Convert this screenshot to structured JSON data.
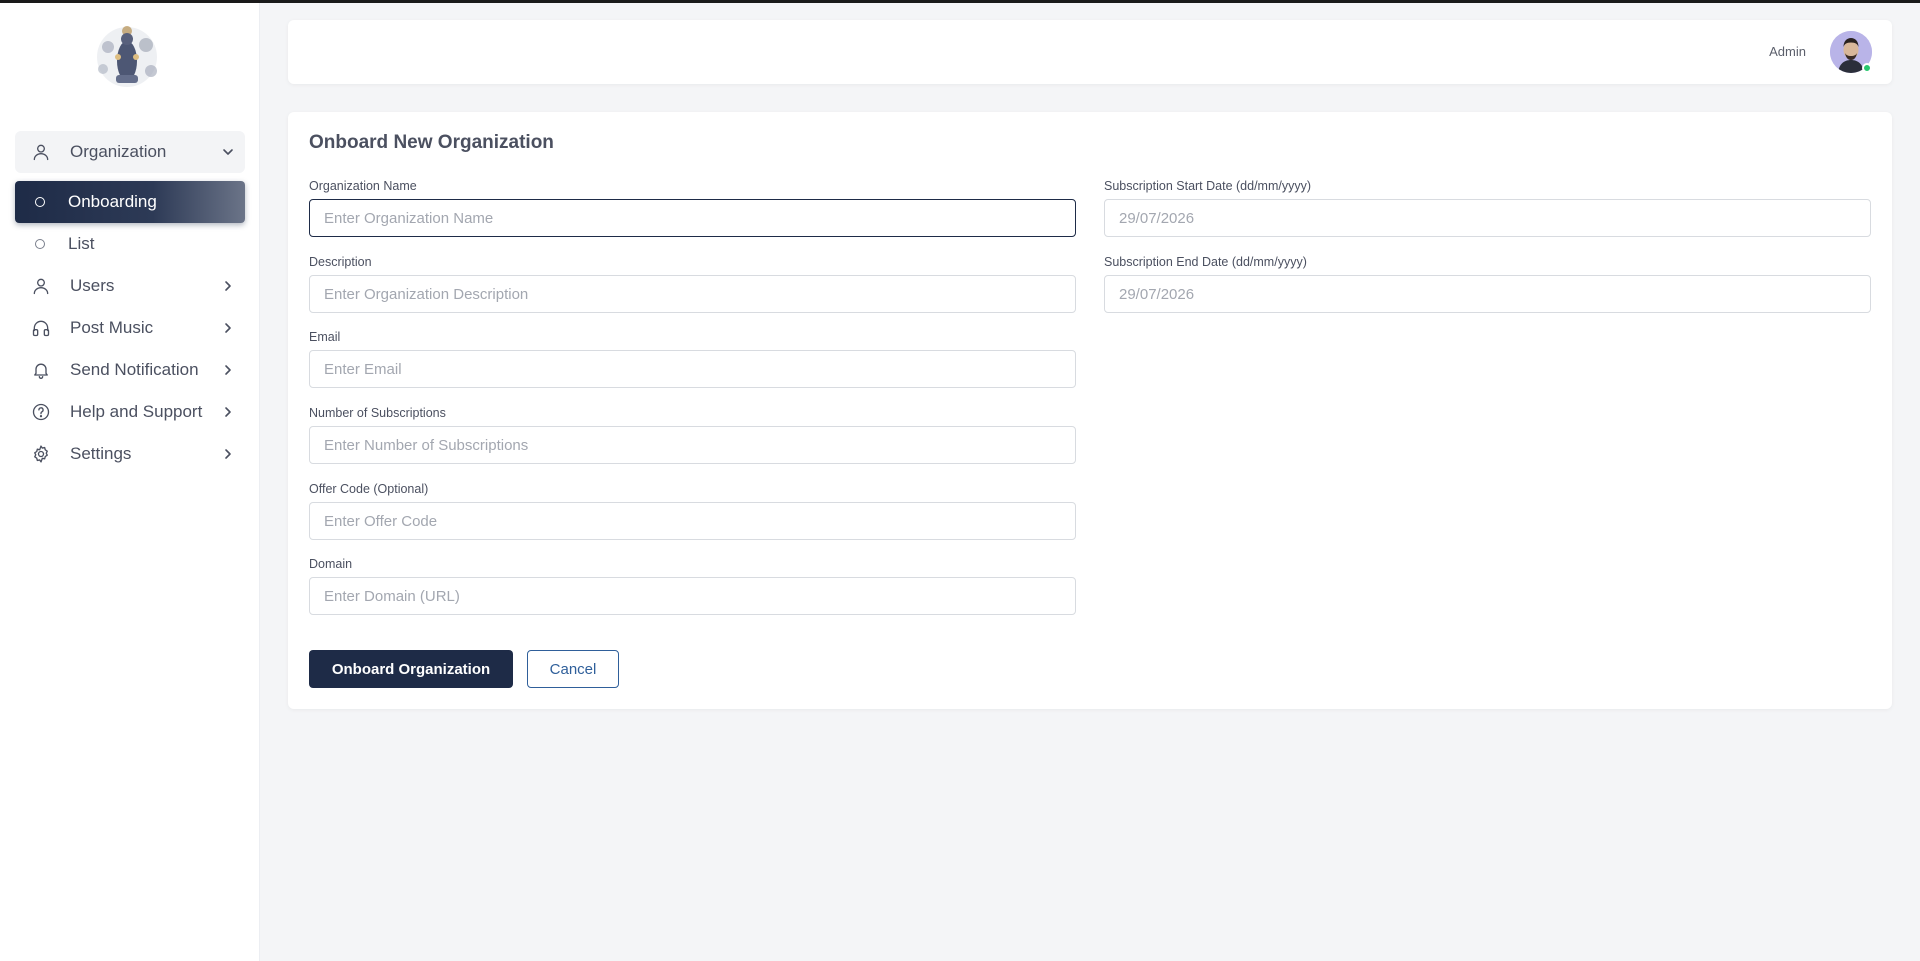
{
  "header": {
    "user_label": "Admin",
    "online_color": "#28c76f"
  },
  "sidebar": {
    "items": [
      {
        "label": "Organization",
        "icon": "user-icon",
        "expanded": true
      },
      {
        "label": "Onboarding",
        "active": true
      },
      {
        "label": "List"
      },
      {
        "label": "Users",
        "icon": "user-icon"
      },
      {
        "label": "Post Music",
        "icon": "headphones-icon"
      },
      {
        "label": "Send Notification",
        "icon": "bell-icon"
      },
      {
        "label": "Help and Support",
        "icon": "help-circle-icon"
      },
      {
        "label": "Settings",
        "icon": "gear-icon"
      }
    ]
  },
  "form": {
    "title": "Onboard New Organization",
    "org_name": {
      "label": "Organization Name",
      "placeholder": "Enter Organization Name"
    },
    "description": {
      "label": "Description",
      "placeholder": "Enter Organization Description"
    },
    "email": {
      "label": "Email",
      "placeholder": "Enter Email"
    },
    "subscriptions": {
      "label": "Number of Subscriptions",
      "placeholder": "Enter Number of Subscriptions"
    },
    "offer_code": {
      "label": "Offer Code (Optional)",
      "placeholder": "Enter Offer Code"
    },
    "domain": {
      "label": "Domain",
      "placeholder": "Enter Domain (URL)"
    },
    "start_date": {
      "label": "Subscription Start Date (dd/mm/yyyy)",
      "placeholder": "29/07/2026"
    },
    "end_date": {
      "label": "Subscription End Date (dd/mm/yyyy)",
      "placeholder": "29/07/2026"
    },
    "submit_label": "Onboard Organization",
    "cancel_label": "Cancel"
  },
  "colors": {
    "primary": "#1e2b47",
    "cancel_text": "#2f5f9a"
  }
}
